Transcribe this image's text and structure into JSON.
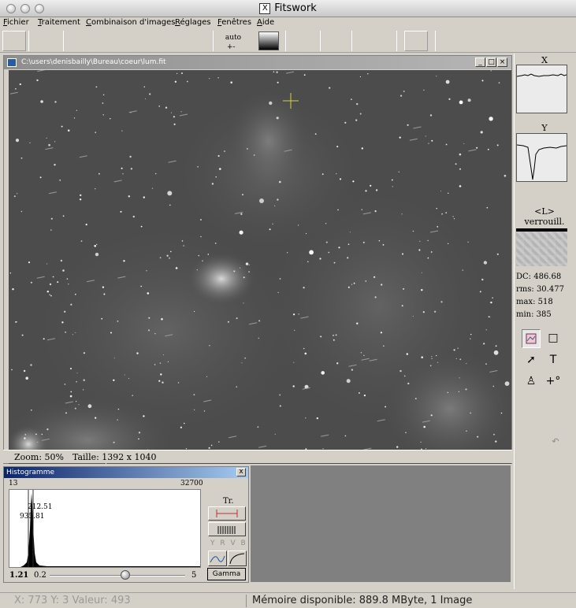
{
  "window": {
    "title": "Fitswork"
  },
  "menu": [
    "Fichier",
    "Traitement",
    "Combinaison d'images",
    "Réglages",
    "Fenêtres",
    "Aide"
  ],
  "toolbar": {
    "auto_label": "auto",
    "auto_sub": "+-"
  },
  "image_window": {
    "path": "C:\\users\\denisbailly\\Bureau\\coeur\\lum.fit",
    "zoom": "Zoom: 50%",
    "size": "Taille: 1392 x 1040"
  },
  "right_panel": {
    "x_label": "X",
    "y_label": "Y",
    "lock_label": "<L> verrouill.",
    "dc": "DC: 486.68",
    "rms": "rms: 30.477",
    "max": "max: 518",
    "min": "min: 385"
  },
  "histogram": {
    "title": "Histogramme",
    "close": "x",
    "min_label": "13",
    "max_label": "32700",
    "low_marker": "935.81",
    "high_marker": "212.51",
    "gamma_value": "1.21",
    "slider_min": "0.2",
    "slider_max": "5",
    "tr_label": "Tr.",
    "channels": "Y R V B",
    "gamma_button": "Gamma"
  },
  "statusbar": {
    "coords": "X: 773  Y: 3  Valeur: 493",
    "memory": "Mémoire disponible: 889.8 MByte, 1 Image"
  }
}
